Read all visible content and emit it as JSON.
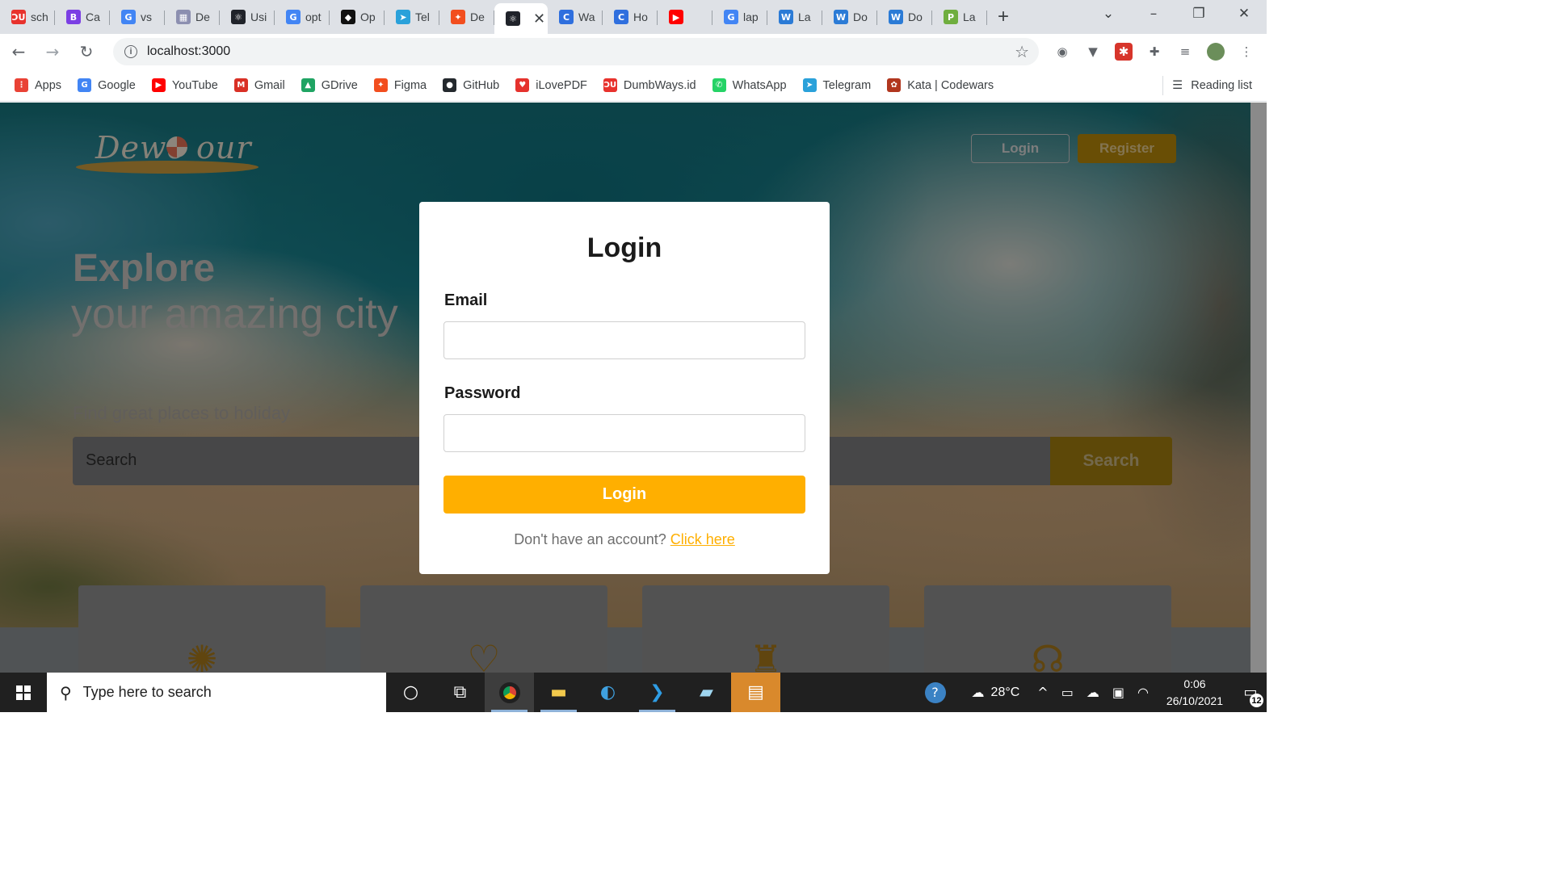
{
  "browser": {
    "tabs": [
      {
        "title": "sch",
        "icon_text": "ƆU",
        "icon_color": "#e8322d"
      },
      {
        "title": "Ca",
        "icon_text": "B",
        "icon_color": "#7b3fe4"
      },
      {
        "title": "vs",
        "icon_text": "G",
        "icon_color": "#4285f4"
      },
      {
        "title": "De",
        "icon_text": "▦",
        "icon_color": "#8c8fb0"
      },
      {
        "title": "Usi",
        "icon_text": "⚛",
        "icon_color": "#20232a"
      },
      {
        "title": "opt",
        "icon_text": "G",
        "icon_color": "#4285f4"
      },
      {
        "title": "Op",
        "icon_text": "◆",
        "icon_color": "#111111"
      },
      {
        "title": "Tel",
        "icon_text": "➤",
        "icon_color": "#2aa1da"
      },
      {
        "title": "De",
        "icon_text": "✦",
        "icon_color": "#f24e1e"
      },
      {
        "title": "",
        "icon_text": "⚛",
        "icon_color": "#20232a",
        "active": true
      },
      {
        "title": "Wa",
        "icon_text": "C",
        "icon_color": "#2f6fde"
      },
      {
        "title": "Ho",
        "icon_text": "C",
        "icon_color": "#2f6fde"
      },
      {
        "title": "",
        "icon_text": "▶",
        "icon_color": "#ff0000"
      },
      {
        "title": "lap",
        "icon_text": "G",
        "icon_color": "#4285f4"
      },
      {
        "title": "La",
        "icon_text": "W",
        "icon_color": "#2b7bd6"
      },
      {
        "title": "Do",
        "icon_text": "W",
        "icon_color": "#2b7bd6"
      },
      {
        "title": "Do",
        "icon_text": "W",
        "icon_color": "#2b7bd6"
      },
      {
        "title": "La",
        "icon_text": "P",
        "icon_color": "#6fae3f"
      }
    ],
    "url": "localhost:3000",
    "bookmarks": [
      {
        "label": "Apps",
        "icon_text": "⋮",
        "icon_color": "#e94235"
      },
      {
        "label": "Google",
        "icon_text": "G",
        "icon_color": "#4285f4"
      },
      {
        "label": "YouTube",
        "icon_text": "▶",
        "icon_color": "#ff0000"
      },
      {
        "label": "Gmail",
        "icon_text": "M",
        "icon_color": "#d93025"
      },
      {
        "label": "GDrive",
        "icon_text": "▲",
        "icon_color": "#1fa463"
      },
      {
        "label": "Figma",
        "icon_text": "✦",
        "icon_color": "#f24e1e"
      },
      {
        "label": "GitHub",
        "icon_text": "●",
        "icon_color": "#24292e"
      },
      {
        "label": "iLovePDF",
        "icon_text": "♥",
        "icon_color": "#e5322d"
      },
      {
        "label": "DumbWays.id",
        "icon_text": "ƆU",
        "icon_color": "#e8322d"
      },
      {
        "label": "WhatsApp",
        "icon_text": "✆",
        "icon_color": "#25d366"
      },
      {
        "label": "Telegram",
        "icon_text": "➤",
        "icon_color": "#2aa1da"
      },
      {
        "label": "Kata | Codewars",
        "icon_text": "✿",
        "icon_color": "#b1361e"
      }
    ],
    "reading_list": "Reading list"
  },
  "page": {
    "logo_text": "Dewe  our",
    "nav_login": "Login",
    "nav_register": "Register",
    "hero_title": "Explore",
    "hero_subtitle": "your amazing city",
    "hero_find": "Find great places to holiday",
    "search_placeholder": "Search",
    "search_button": "Search"
  },
  "modal": {
    "title": "Login",
    "email_label": "Email",
    "email_value": "",
    "password_label": "Password",
    "password_value": "",
    "submit_label": "Login",
    "footer_text": "Don't have an account? ",
    "footer_link": "Click here"
  },
  "taskbar": {
    "search_placeholder": "Type here to search",
    "temperature": "28°C",
    "time": "0:06",
    "date": "26/10/2021",
    "notification_count": "12"
  }
}
